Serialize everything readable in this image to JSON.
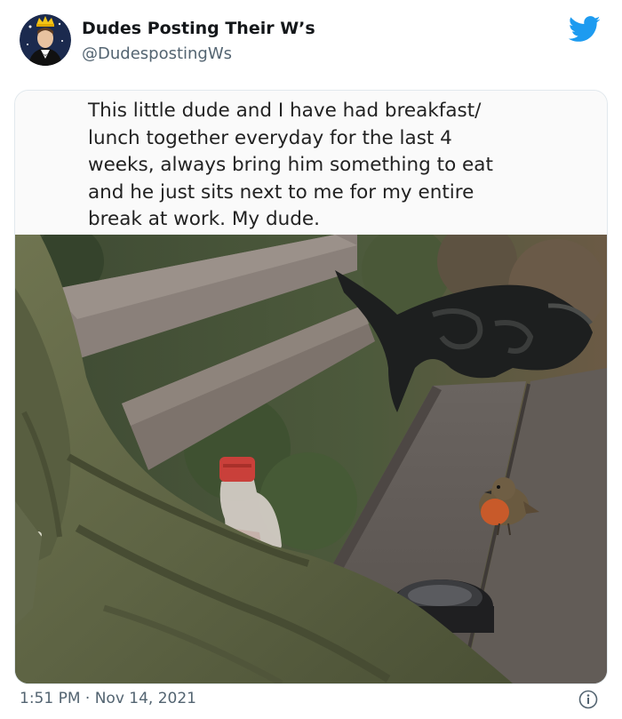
{
  "author": {
    "name": "Dudes Posting Their W’s",
    "handle": "@DudespostingWs"
  },
  "post": {
    "caption": "This little dude and I have had breakfast/\nlunch together everyday for the last 4\nweeks, always bring him something to eat\nand he just sits next to me for my entire\nbreak at work. My dude.",
    "timestamp": "1:51 PM · Nov 14, 2021"
  },
  "icons": {
    "platform": "twitter-bird-icon",
    "info": "info-icon"
  },
  "colors": {
    "brand_blue": "#1d9bf0",
    "name_text": "#14171a",
    "secondary_text": "#536471"
  }
}
